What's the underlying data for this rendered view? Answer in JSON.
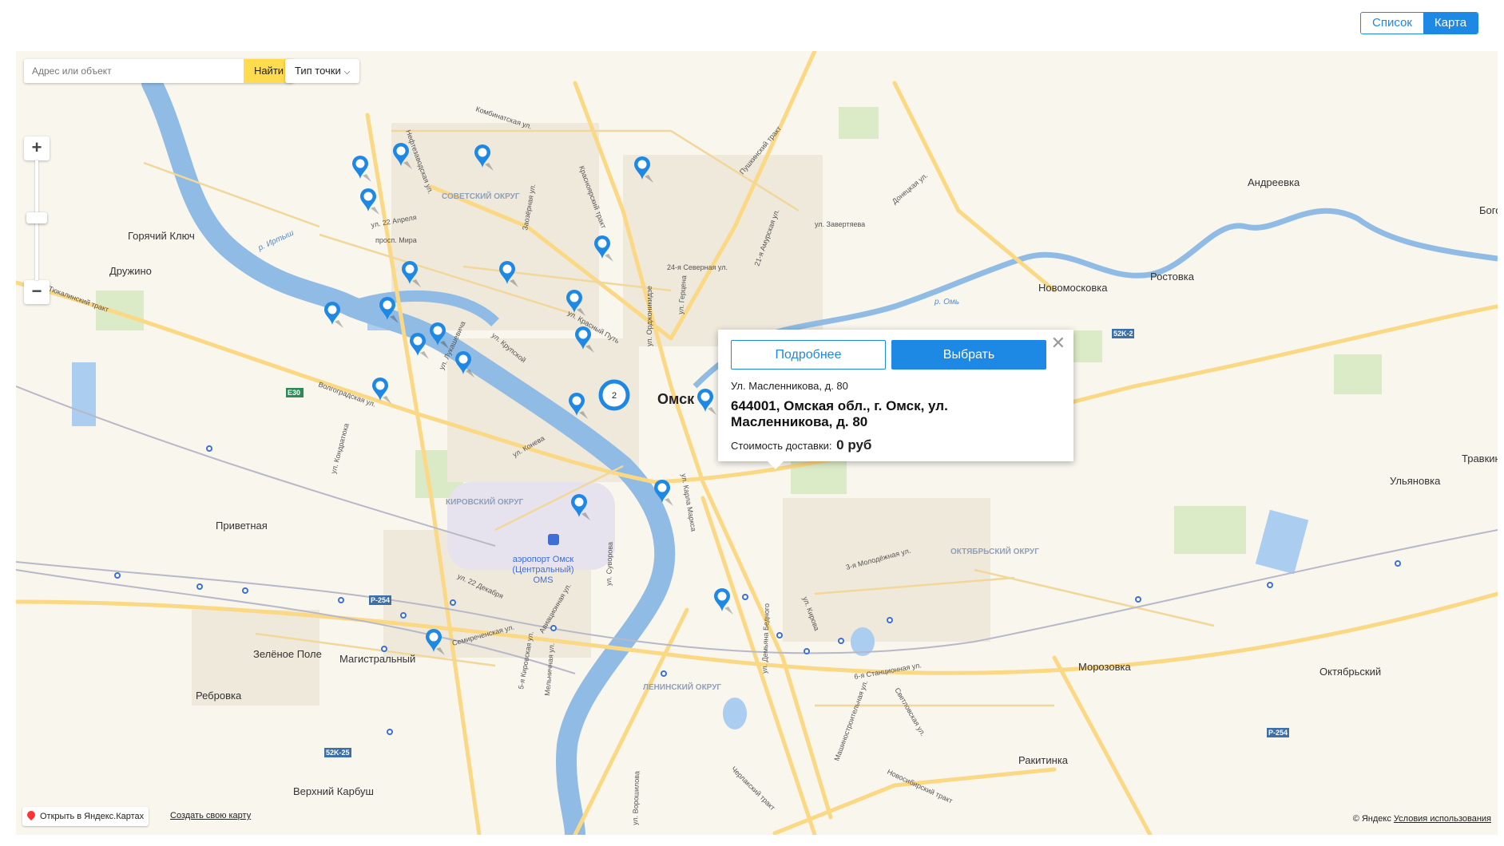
{
  "view_toggle": {
    "list_label": "Список",
    "map_label": "Карта",
    "active": "Карта"
  },
  "search": {
    "placeholder": "Адрес или объект",
    "button_label": "Найти"
  },
  "type_filter": {
    "label": "Тип точки"
  },
  "zoom": {
    "in_label": "+",
    "out_label": "−"
  },
  "popup": {
    "more_label": "Подробнее",
    "select_label": "Выбрать",
    "short_address": "Ул. Масленникова, д. 80",
    "full_address": "644001, Омская обл., г. Омск, ул. Масленникова, д. 80",
    "price_label": "Стоимость доставки:",
    "price_value": "0 руб"
  },
  "cluster": {
    "count": "2"
  },
  "map_places": [
    "Омск",
    "Андреевка",
    "Горячий Ключ",
    "Дружино",
    "Новомосковка",
    "Ростовка",
    "Ульяновка",
    "Травкино",
    "Приветная",
    "Зелёное Поле",
    "Магистральный",
    "Ребровка",
    "Верхний Карбуш",
    "Морозовка",
    "Октябрьский",
    "Ракитинка",
    "Бого"
  ],
  "map_districts": [
    "СОВЕТСКИЙ ОКРУГ",
    "КИРОВСКИЙ ОКРУГ",
    "ОКТЯБРЬСКИЙ ОКРУГ",
    "ЛЕНИНСКИЙ ОКРУГ"
  ],
  "airport": {
    "line1": "аэропорт Омск",
    "line2": "(Центральный)",
    "line3": "OMS"
  },
  "map_streets": [
    "Комбинатская ул.",
    "Нефтезаводская ул.",
    "ул. 22 Апреля",
    "просп. Мира",
    "Красноярский тракт",
    "Заозёрная ул.",
    "Пушкинский тракт",
    "21-я Амурская ул.",
    "ул. Завертяева",
    "Донецкая ул.",
    "24-я Северная ул.",
    "ул. Красный Путь",
    "ул. Герцена",
    "ул. Орджоникидзе",
    "ул. Лукашевича",
    "ул. Крупской",
    "Волгоградская ул.",
    "ул. Конева",
    "ул. Кондратюка",
    "ул. 22 Декабря",
    "Семиреченская ул.",
    "5-я Кировская ул.",
    "Мельничная ул.",
    "ул. Суворова",
    "ул. Карла Маркса",
    "3-я Молодёжная ул.",
    "6-я Станционная ул.",
    "ул. Кирова",
    "ул. Демьяна Бедного",
    "Машиностроительная ул.",
    "Светловская ул.",
    "Новосибирский тракт",
    "Черлакский тракт",
    "ул. Ворошилова",
    "Тюкалинский тракт",
    "Авиационная ул.",
    "р. Иртыш",
    "р. Омь"
  ],
  "map_roads": [
    "E30",
    "P-254",
    "52К-2",
    "52К-25"
  ],
  "footer": {
    "open_label": "Открыть в Яндекс.Картах",
    "create_label": "Создать свою карту",
    "copyright": "© Яндекс",
    "terms": "Условия использования"
  },
  "colors": {
    "accent": "#1e88e5",
    "search_button": "#ffdb4d",
    "river": "#8fbbe4",
    "road": "#fbd884"
  }
}
